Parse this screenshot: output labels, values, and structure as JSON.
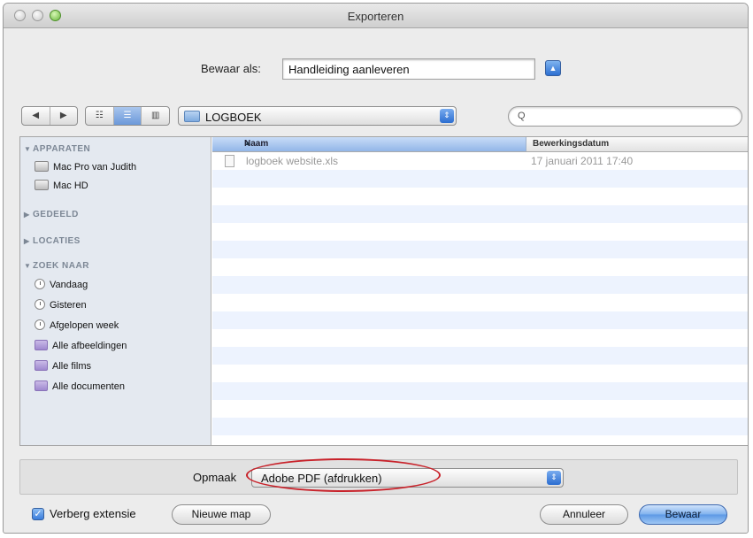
{
  "window": {
    "title": "Exporteren"
  },
  "save_as": {
    "label": "Bewaar als:",
    "value": "Handleiding aanleveren"
  },
  "toolbar": {
    "nav": [
      "◀",
      "▶"
    ],
    "views": [
      "☷",
      "☰",
      "▥"
    ],
    "folder": "LOGBOEK",
    "search_placeholder": "",
    "search_icon": "Q"
  },
  "sidebar": {
    "sections": [
      {
        "title": "APPARATEN",
        "expanded": true
      },
      {
        "title": "GEDEELD",
        "expanded": false
      },
      {
        "title": "LOCATIES",
        "expanded": false
      },
      {
        "title": "ZOEK NAAR",
        "expanded": true
      }
    ],
    "devices": [
      "Mac Pro van Judith",
      "Mac HD"
    ],
    "search_items": [
      "Vandaag",
      "Gisteren",
      "Afgelopen week",
      "Alle afbeeldingen",
      "Alle films",
      "Alle documenten"
    ]
  },
  "list": {
    "columns": {
      "name": "Naam",
      "date": "Bewerkingsdatum"
    },
    "files": [
      {
        "name": "logboek website.xls",
        "date": "17 januari 2011 17:40"
      }
    ]
  },
  "format": {
    "label": "Opmaak",
    "value": "Adobe PDF (afdrukken)"
  },
  "footer": {
    "hide_extension_label": "Verberg extensie",
    "hide_extension_checked": true,
    "new_folder": "Nieuwe map",
    "cancel": "Annuleer",
    "save": "Bewaar"
  },
  "colors": {
    "accent": "#3a7ddc",
    "highlight": "#c8222a"
  }
}
